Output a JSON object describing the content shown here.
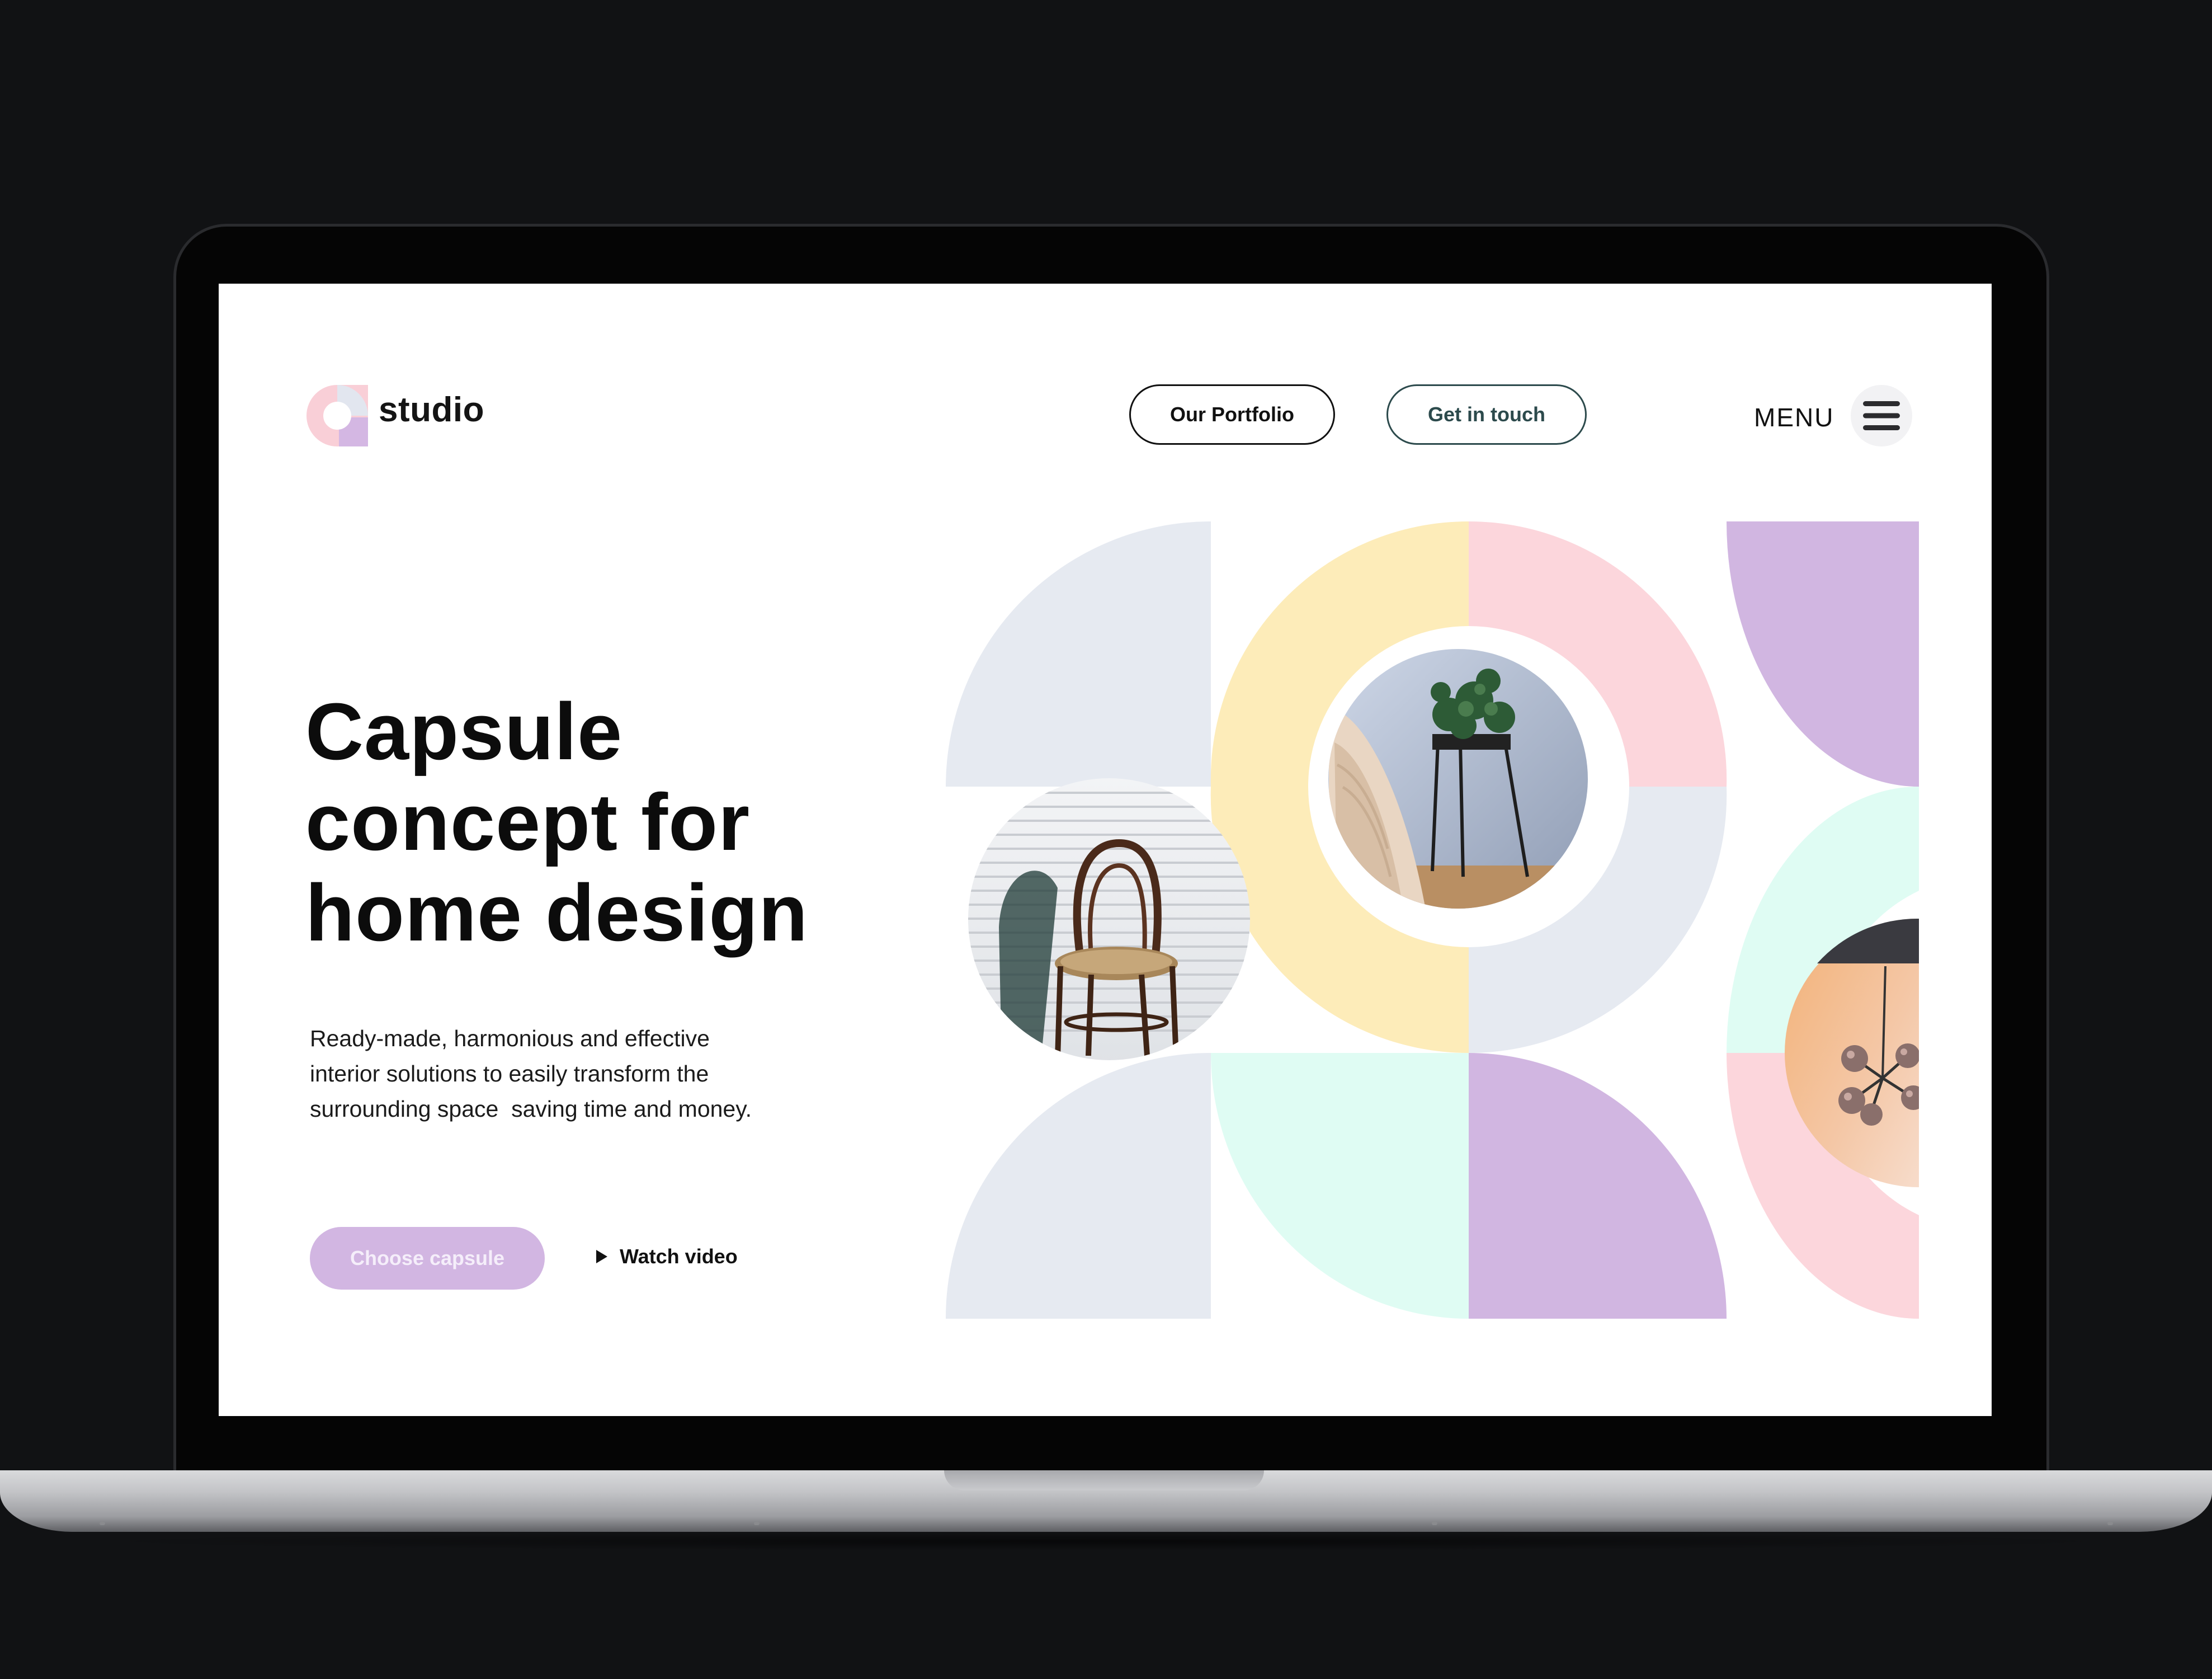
{
  "brand": {
    "name": "studio"
  },
  "nav": {
    "portfolio_label": "Our Portfolio",
    "contact_label": "Get in touch",
    "menu_label": "MENU"
  },
  "hero": {
    "title_lines": [
      "Capsule",
      "concept for",
      "home design"
    ],
    "description_lines": [
      "Ready-made, harmonious and effective",
      "interior solutions to easily transform the",
      "surrounding space  saving time and money."
    ],
    "cta_primary": "Choose capsule",
    "cta_secondary": "Watch video"
  },
  "colors": {
    "lavender": "#d1b6e1",
    "pink": "#fcd6dc",
    "yellow": "#fdecb9",
    "mint": "#dffcf3",
    "blue_gray": "#e6eaf1",
    "teal_text": "#2c4a4c"
  },
  "images": [
    {
      "name": "bentwood-chair-photo"
    },
    {
      "name": "plant-stand-and-knit-blanket-photo"
    },
    {
      "name": "pendant-lamp-photo"
    }
  ]
}
